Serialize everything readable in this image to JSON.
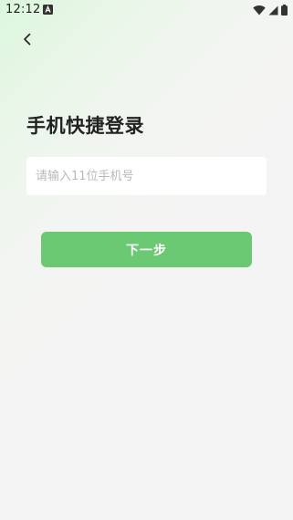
{
  "status_bar": {
    "time": "12:12",
    "notification_icon": "a-letter-icon",
    "wifi_icon": "wifi-icon",
    "signal_icon": "signal-icon",
    "battery_icon": "battery-icon"
  },
  "header": {
    "back_icon": "chevron-left-icon"
  },
  "main": {
    "title": "手机快捷登录",
    "phone_input": {
      "value": "",
      "placeholder": "请输入11位手机号"
    },
    "next_button_label": "下一步"
  },
  "colors": {
    "accent": "#6bc974",
    "background": "#f4f4f4",
    "gradient_tint": "#dcf7dd",
    "title_text": "#222222",
    "placeholder_text": "#b9b9b9",
    "input_background": "#ffffff"
  }
}
